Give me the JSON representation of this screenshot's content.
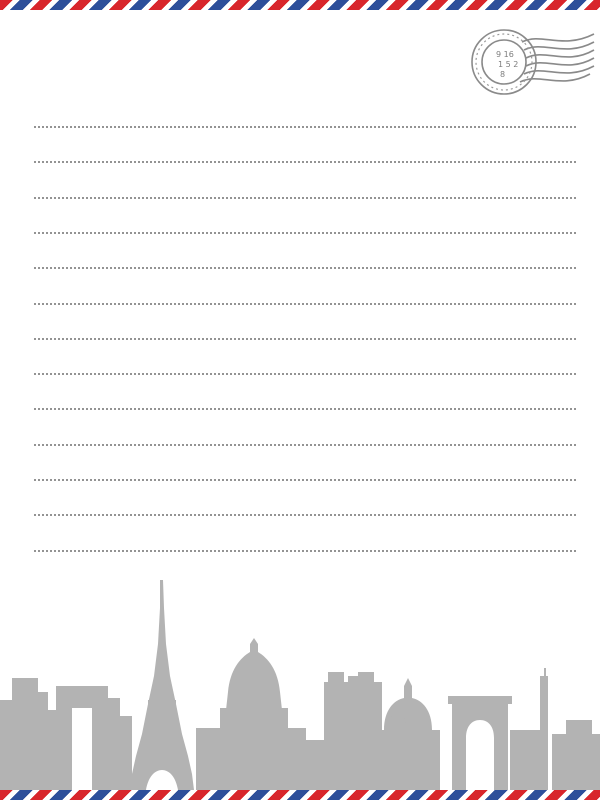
{
  "stationery": {
    "colors": {
      "airmail_red": "#d8262c",
      "airmail_blue": "#2d4f9a",
      "writing_line": "#6f6f6f",
      "skyline": "#b3b3b3",
      "postmark": "#8a8a8a"
    },
    "writing_line_count": 13,
    "icons": [
      "airmail-border",
      "postmark-stamp-icon",
      "paris-skyline-illustration",
      "eiffel-tower-icon"
    ]
  }
}
